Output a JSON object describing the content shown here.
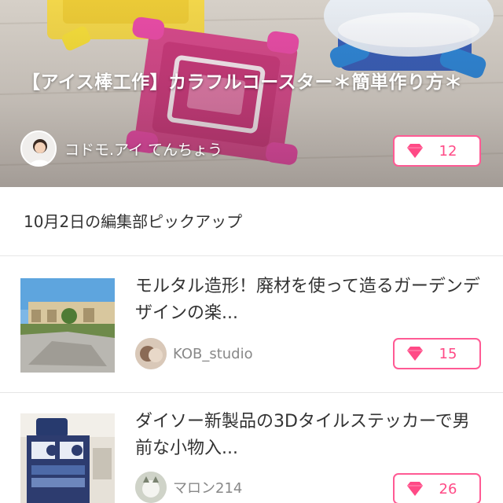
{
  "hero": {
    "title": "【アイス棒工作】カラフルコースター＊簡単作り方＊",
    "author": "コドモ.アイ てんちょう",
    "likes": "12"
  },
  "section": {
    "title": "10月2日の編集部ピックアップ"
  },
  "items": [
    {
      "title": "モルタル造形！廃材を使って造るガーデンデザインの楽...",
      "author": "KOB_studio",
      "likes": "15"
    },
    {
      "title": "ダイソー新製品の3Dタイルステッカーで男前な小物入...",
      "author": "マロン214",
      "likes": "26"
    }
  ],
  "colors": {
    "accent": "#ff4a86",
    "divider": "#e6e6e6"
  },
  "icons": {
    "like": "heart-icon"
  }
}
